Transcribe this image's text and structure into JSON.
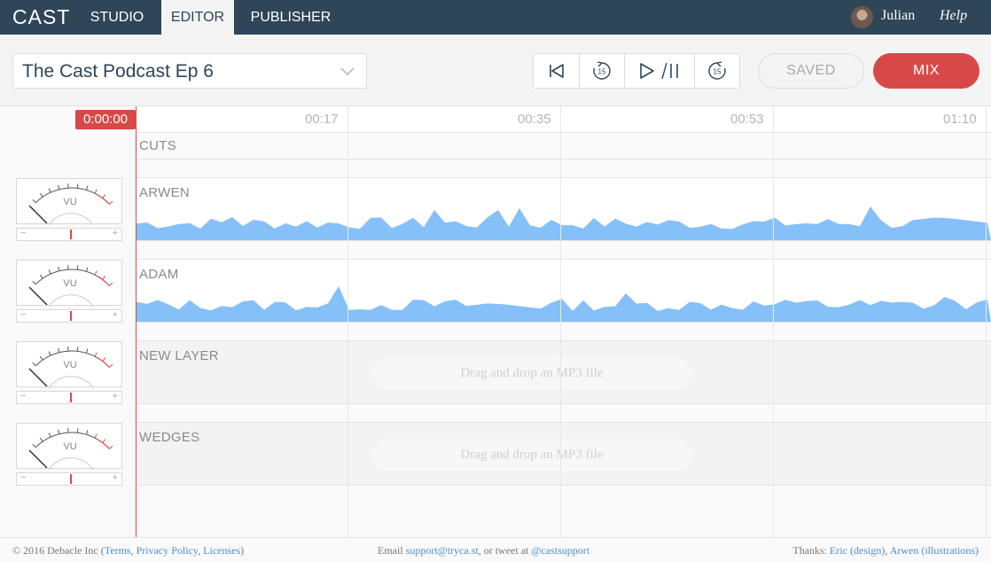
{
  "nav": {
    "logo": "CAST",
    "tabs": [
      {
        "label": "STUDIO"
      },
      {
        "label": "EDITOR",
        "active": true
      },
      {
        "label": "PUBLISHER"
      }
    ],
    "user": "Julian",
    "help": "Help"
  },
  "toolbar": {
    "episode_title": "The Cast Podcast Ep 6",
    "transport_icons": [
      "skip-to-start-icon",
      "rewind-15-icon",
      "play-pause-icon",
      "forward-15-icon"
    ],
    "rewind_seconds": "15",
    "forward_seconds": "15",
    "saved_label": "SAVED",
    "mix_label": "MIX"
  },
  "timeline": {
    "current_time": "0:00:00",
    "ticks": [
      "00:17",
      "00:35",
      "00:53",
      "01:10"
    ]
  },
  "tracks": [
    {
      "label": "CUTS",
      "kind": "cuts"
    },
    {
      "label": "ARWEN",
      "kind": "audio"
    },
    {
      "label": "ADAM",
      "kind": "audio"
    },
    {
      "label": "NEW LAYER",
      "kind": "empty",
      "dropzone": "Drag and drop an MP3 file"
    },
    {
      "label": "WEDGES",
      "kind": "empty",
      "dropzone": "Drag and drop an MP3 file"
    }
  ],
  "meters": {
    "vu_label": "VU",
    "minus": "−",
    "plus": "+"
  },
  "colors": {
    "nav_bg": "#2f4558",
    "accent_red": "#d94848",
    "waveform": "#85c0f9"
  },
  "footer": {
    "copyright_prefix": "© 2016 Debacle Inc (",
    "terms": "Terms",
    "privacy": "Privacy Policy",
    "licenses": "Licenses",
    "close_paren": ")",
    "comma1": ", ",
    "comma2": ", ",
    "email_prefix": "Email ",
    "email": "support@tryca.st",
    "tweet_prefix": ", or tweet at ",
    "twitter": "@castsupport",
    "thanks_prefix": "Thanks: ",
    "thanks1": "Eric (design)",
    "thanks_sep": ", ",
    "thanks2": "Arwen (illustrations)"
  }
}
